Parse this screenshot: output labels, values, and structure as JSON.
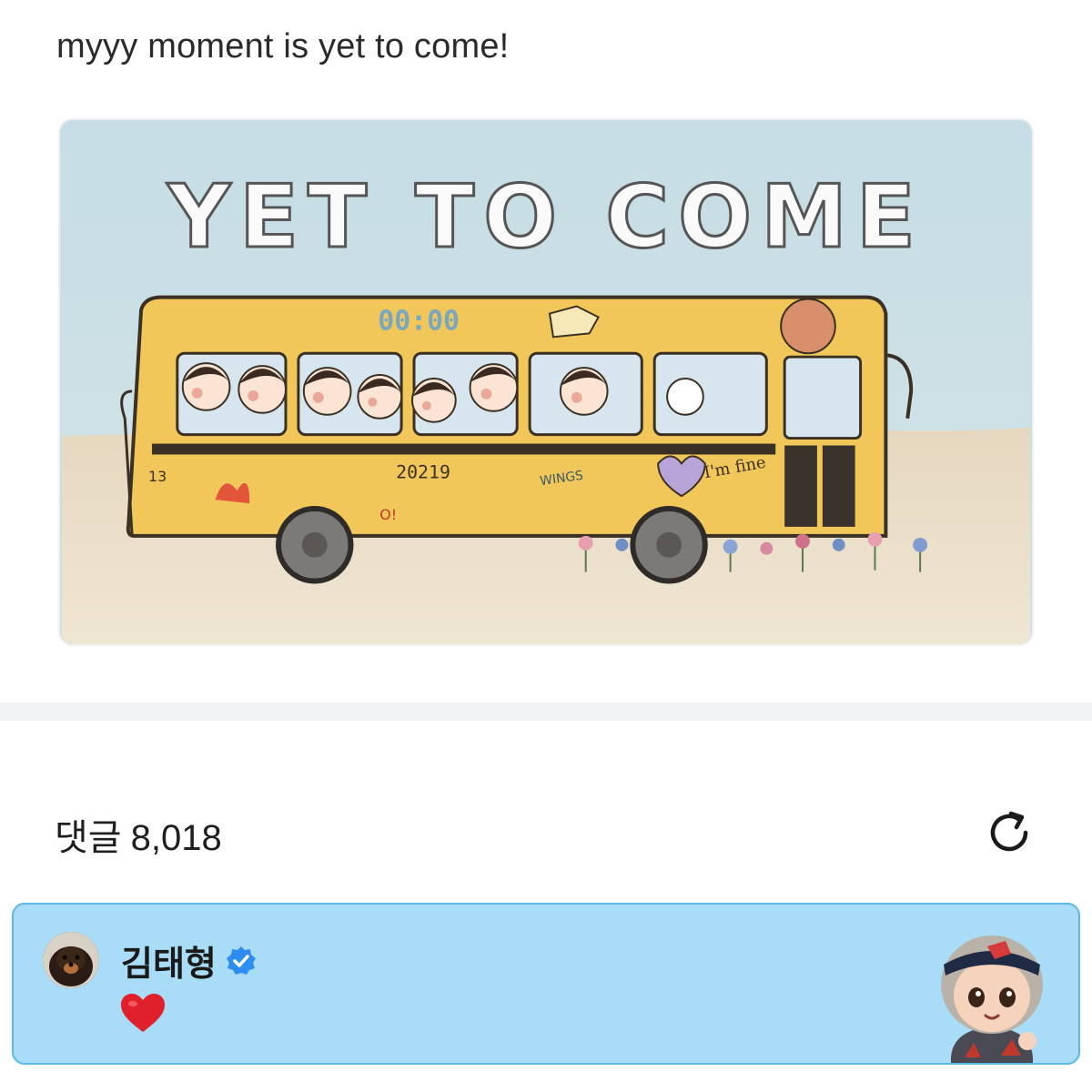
{
  "post": {
    "text": "myyy moment is yet to come!",
    "image_text": {
      "headline": "YET TO COME",
      "clock": "00:00",
      "plate": "20219",
      "side_number": "13",
      "sticker_wings": "WINGS",
      "sticker_im_fine": "I'm fine",
      "sticker_oh": "O!"
    }
  },
  "comments": {
    "label": "댓글",
    "count": "8,018",
    "refresh_icon": "refresh-icon",
    "items": [
      {
        "author": "김태형",
        "verified": true,
        "body_icon": "red-heart-emoji",
        "highlight_color": "#a9dcf6"
      }
    ]
  },
  "colors": {
    "card_bg": "#a9dcf6",
    "card_border": "#5cb6e6",
    "verified": "#2f8cf0",
    "heart": "#e0202a",
    "bus": "#f2c75a"
  }
}
